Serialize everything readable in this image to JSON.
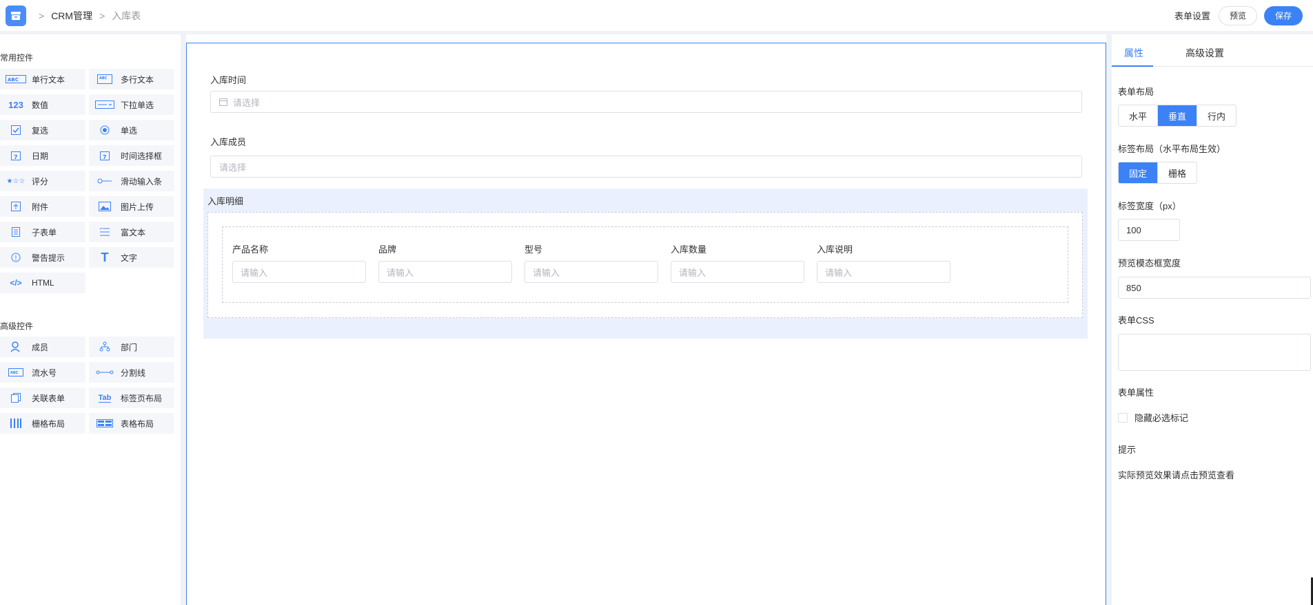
{
  "header": {
    "breadcrumb": [
      "CRM管理",
      "入库表"
    ],
    "form_settings": "表单设置",
    "preview": "预览",
    "save": "保存"
  },
  "widgets": {
    "common_title": "常用控件",
    "common": [
      {
        "label": "单行文本",
        "icon": "single-line-text-icon"
      },
      {
        "label": "多行文本",
        "icon": "multi-line-text-icon"
      },
      {
        "label": "数值",
        "icon": "number-icon"
      },
      {
        "label": "下拉单选",
        "icon": "dropdown-icon"
      },
      {
        "label": "复选",
        "icon": "checkbox-icon"
      },
      {
        "label": "单选",
        "icon": "radio-icon"
      },
      {
        "label": "日期",
        "icon": "date-icon"
      },
      {
        "label": "时间选择框",
        "icon": "time-icon"
      },
      {
        "label": "评分",
        "icon": "rating-icon"
      },
      {
        "label": "滑动输入条",
        "icon": "slider-icon"
      },
      {
        "label": "附件",
        "icon": "attachment-icon"
      },
      {
        "label": "图片上传",
        "icon": "image-upload-icon"
      },
      {
        "label": "子表单",
        "icon": "subform-icon"
      },
      {
        "label": "富文本",
        "icon": "rich-text-icon"
      },
      {
        "label": "警告提示",
        "icon": "alert-icon"
      },
      {
        "label": "文字",
        "icon": "text-icon"
      },
      {
        "label": "HTML",
        "icon": "html-icon"
      }
    ],
    "advanced_title": "高级控件",
    "advanced": [
      {
        "label": "成员",
        "icon": "member-icon"
      },
      {
        "label": "部门",
        "icon": "department-icon"
      },
      {
        "label": "流水号",
        "icon": "serial-number-icon"
      },
      {
        "label": "分割线",
        "icon": "divider-icon"
      },
      {
        "label": "关联表单",
        "icon": "linked-form-icon"
      },
      {
        "label": "标签页布局",
        "icon": "tab-layout-icon"
      },
      {
        "label": "栅格布局",
        "icon": "grid-layout-icon"
      },
      {
        "label": "表格布局",
        "icon": "table-layout-icon"
      }
    ]
  },
  "form": {
    "field1_label": "入库时间",
    "field1_placeholder": "请选择",
    "field2_label": "入库成员",
    "field2_placeholder": "请选择",
    "subform_title": "入库明细",
    "columns": [
      "产品名称",
      "品牌",
      "型号",
      "入库数量",
      "入库说明"
    ],
    "column_placeholder": "请输入"
  },
  "props": {
    "tab_attrs": "属性",
    "tab_advanced": "高级设置",
    "layout_label": "表单布局",
    "layout_options": [
      "水平",
      "垂直",
      "行内"
    ],
    "layout_selected": "垂直",
    "label_layout_label": "标签布局（水平布局生效）",
    "label_layout_options": [
      "固定",
      "栅格"
    ],
    "label_layout_selected": "固定",
    "label_width_label": "标签宽度（px）",
    "label_width_value": "100",
    "modal_width_label": "预览模态框宽度",
    "modal_width_value": "850",
    "css_label": "表单CSS",
    "form_attr_label": "表单属性",
    "hide_required_label": "隐藏必选标记",
    "hint_title": "提示",
    "hint_text": "实际预览效果请点击预览查看"
  },
  "colors": {
    "accent": "#3b82f6",
    "subform_bg": "#eaf0fd"
  }
}
